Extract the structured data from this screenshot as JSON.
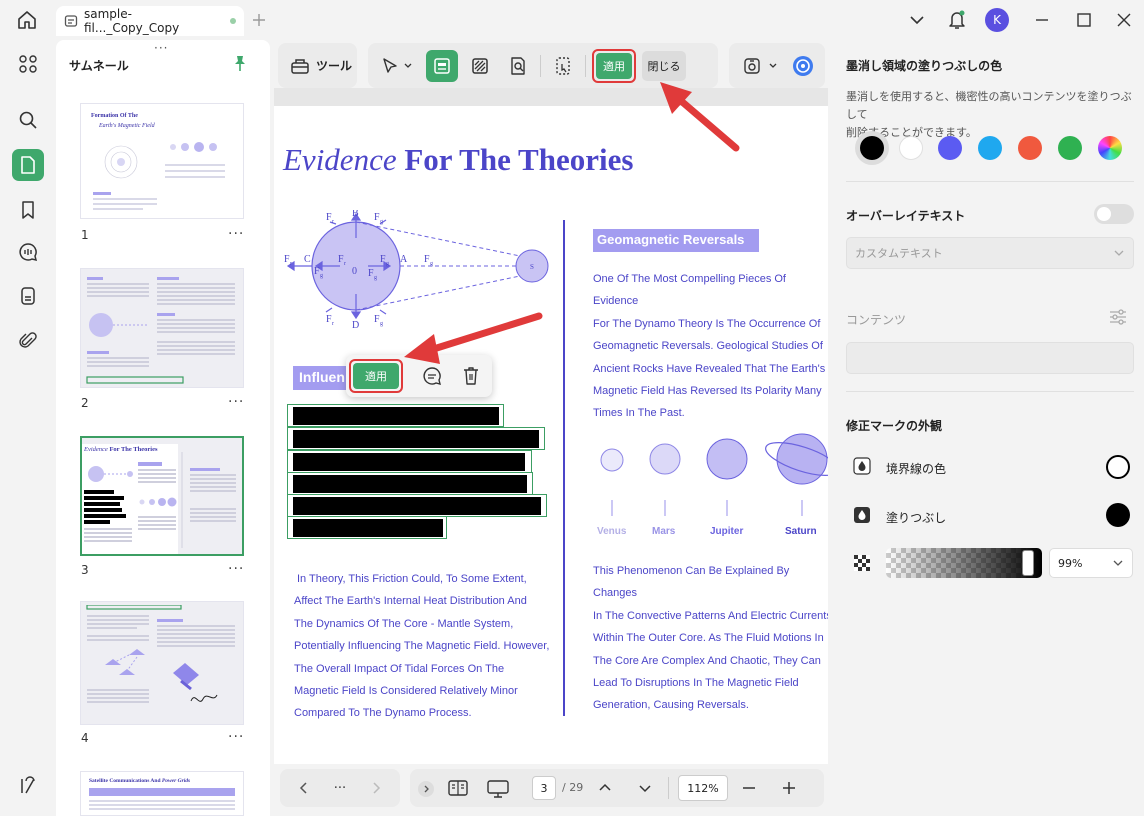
{
  "titlebar": {
    "tab_title": "sample-fil..._Copy_Copy",
    "avatar_letter": "K"
  },
  "thumbnails": {
    "title": "サムネール",
    "pages": [
      {
        "num": "1",
        "heading_a": "Formation Of The",
        "heading_b": "Earth's Magnetic Field"
      },
      {
        "num": "2"
      },
      {
        "num": "3",
        "heading_a": "Evidence",
        "heading_b": "For The Theories"
      },
      {
        "num": "4"
      },
      {
        "heading_a": "Satellite Communications And",
        "heading_b": "Power Grids"
      }
    ]
  },
  "toolbar": {
    "tools_label": "ツール",
    "apply_label": "適用",
    "close_label": "閉じる"
  },
  "document": {
    "title_italic": "Evidence",
    "title_bold": "For The Theories",
    "diagram": {
      "labels": [
        "F",
        "r",
        "B",
        "F",
        "g",
        "F",
        "r",
        "C",
        "F",
        "g",
        "F",
        "r",
        "F",
        "g",
        "A",
        "F",
        "g",
        "0",
        "F",
        "g",
        "F",
        "r",
        "D",
        "F",
        "g",
        "S"
      ]
    },
    "influence_label": "Influen",
    "popup": {
      "apply_label": "適用"
    },
    "left_paragraph": [
      "In Theory, This Friction Could, To Some Extent,",
      "Affect The Earth's Internal Heat Distribution And",
      "The Dynamics Of The Core - Mantle System,",
      "Potentially Influencing The Magnetic Field. However,",
      "The Overall Impact Of Tidal Forces On The",
      "Magnetic Field Is Considered Relatively Minor",
      "Compared To The Dynamo Process."
    ],
    "section_title": "Geomagnetic Reversals",
    "right_paragraph1": [
      "One Of The Most Compelling Pieces Of Evidence",
      "For The Dynamo Theory Is The Occurrence Of",
      "Geomagnetic Reversals. Geological Studies Of",
      "Ancient Rocks Have Revealed That The Earth's",
      "Magnetic Field Has Reversed Its Polarity Many",
      "Times In The Past."
    ],
    "planets": [
      "Venus",
      "Mars",
      "Jupiter",
      "Saturn"
    ],
    "right_paragraph2": [
      "This Phenomenon Can Be Explained By Changes",
      "In The Convective Patterns And Electric Currents",
      "Within The Outer Core. As The Fluid Motions In",
      "The Core Are Complex And Chaotic, They Can",
      "Lead To Disruptions In The Magnetic Field",
      "Generation, Causing Reversals."
    ]
  },
  "bottombar": {
    "current_page": "3",
    "total_pages": "/ 29",
    "zoom": "112%",
    "more": "···"
  },
  "right_panel": {
    "fill_color_title": "墨消し領域の塗りつぶしの色",
    "fill_color_desc_1": "墨消しを使用すると、機密性の高いコンテンツを塗りつぶして",
    "fill_color_desc_2": "削除することができます。",
    "swatches": [
      "#000000",
      "#ffffff",
      "#5b5bf2",
      "#1fa8ef",
      "#f0593e",
      "#2fb151",
      "rainbow"
    ],
    "overlay_title": "オーバーレイテキスト",
    "custom_text_placeholder": "カスタムテキスト",
    "content_label": "コンテンツ",
    "appearance_title": "修正マークの外観",
    "border_color_label": "境界線の色",
    "fill_label": "塗りつぶし",
    "opacity_value": "99%"
  },
  "colors": {
    "accent": "#3fa86c",
    "doc_purple": "#4b45c8",
    "highlight_red": "#e03a3a"
  }
}
